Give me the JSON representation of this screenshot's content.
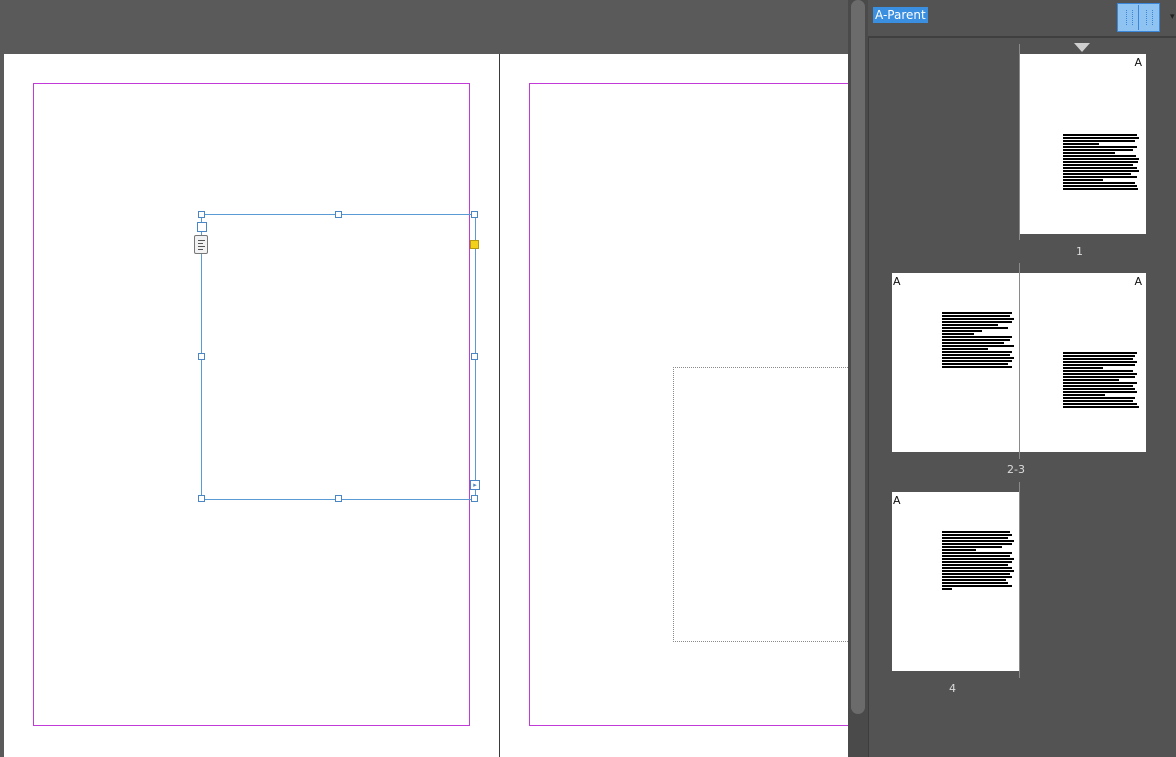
{
  "pages_panel": {
    "parent_label": "A-Parent",
    "parent_prefix": "A",
    "page_numbers": [
      "1",
      "2-3",
      "4"
    ]
  },
  "colors": {
    "margin_guide": "#c23ad8",
    "frame_selection": "#5b9bd5",
    "live_corner": "#f3d11b",
    "panel_highlight": "#3b8fe0"
  },
  "icons": {
    "out_port": "overflow-arrow-icon",
    "thread_marker": "text-thread-icon"
  }
}
